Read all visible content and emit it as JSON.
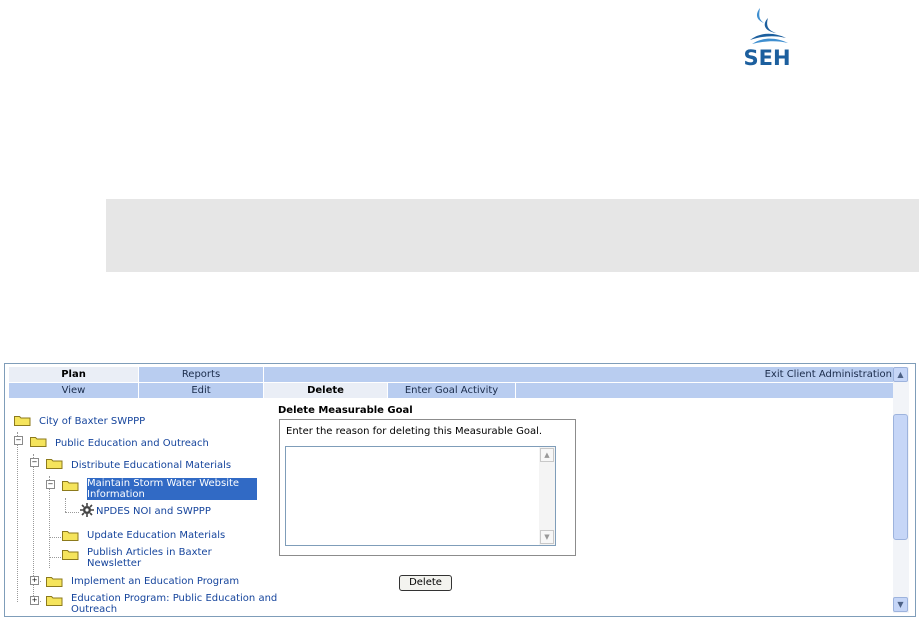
{
  "logo": {
    "text": "SEH"
  },
  "tabs": {
    "row1": [
      {
        "label": "Plan",
        "active": true
      },
      {
        "label": "Reports",
        "active": false
      }
    ],
    "exit_label": "Exit Client Administration",
    "row2": [
      {
        "label": "View",
        "active": false
      },
      {
        "label": "Edit",
        "active": false
      },
      {
        "label": "Delete",
        "active": true
      },
      {
        "label": "Enter Goal Activity",
        "active": false
      }
    ]
  },
  "tree": {
    "root": "City of Baxter SWPPP",
    "l1": "Public Education and Outreach",
    "l2a": "Distribute Educational Materials",
    "l3a": "Maintain Storm Water Website Information",
    "l4a": "NPDES NOI and SWPPP",
    "l3b": "Update Education Materials",
    "l3c": "Publish Articles in Baxter Newsletter",
    "l2b": "Implement an Education Program",
    "l2c": "Education Program: Public Education and Outreach"
  },
  "form": {
    "title": "Delete Measurable Goal",
    "prompt": "Enter the reason for deleting this Measurable Goal.",
    "reason_value": "",
    "delete_label": "Delete"
  }
}
